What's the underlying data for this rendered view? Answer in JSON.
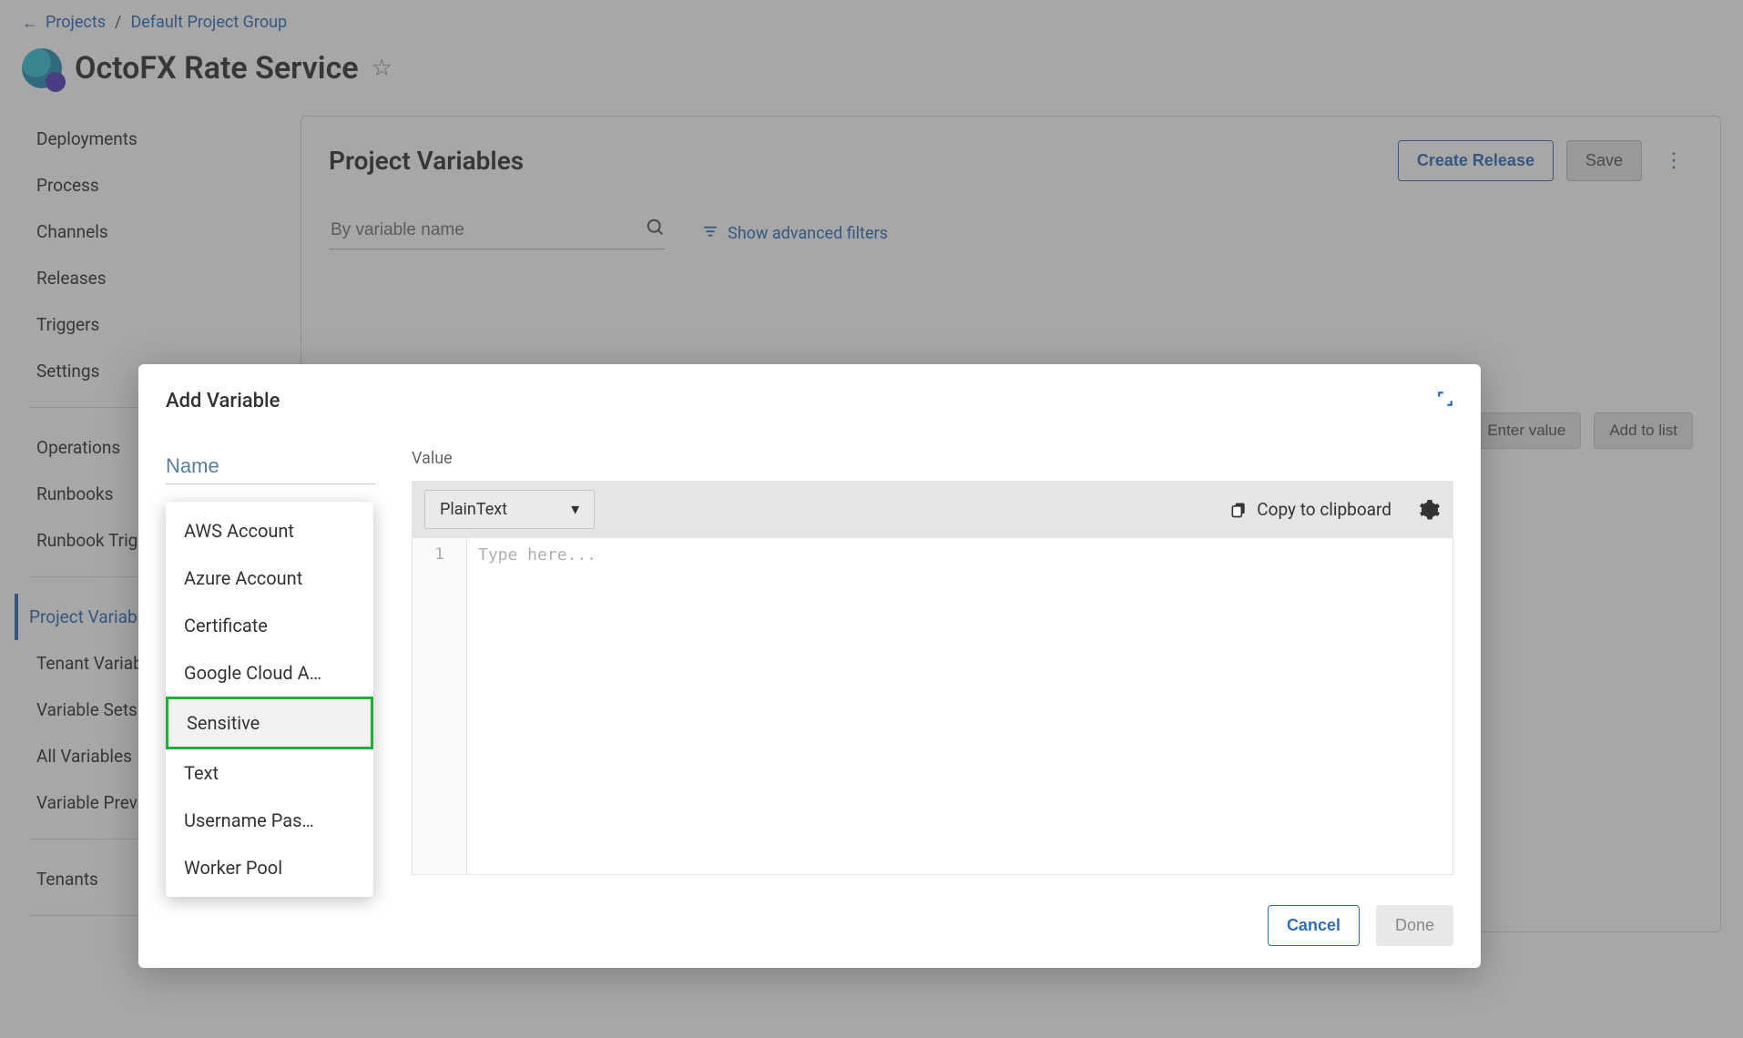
{
  "breadcrumbs": {
    "projects": "Projects",
    "group": "Default Project Group"
  },
  "project_title": "OctoFX Rate Service",
  "sidebar": {
    "items": [
      "Deployments",
      "Process",
      "Channels",
      "Releases",
      "Triggers",
      "Settings"
    ],
    "items2": [
      "Operations",
      "Runbooks",
      "Runbook Triggers"
    ],
    "items3": [
      "Project Variables",
      "Tenant Variables",
      "Variable Sets",
      "All Variables",
      "Variable Preview"
    ],
    "items4": [
      "Tenants"
    ]
  },
  "main": {
    "title": "Project Variables",
    "create_release": "Create Release",
    "save": "Save",
    "search_placeholder": "By variable name",
    "adv_filters": "Show advanced filters",
    "value_btn": "Enter value",
    "addlist_btn": "Add to list"
  },
  "modal": {
    "title": "Add Variable",
    "name_placeholder": "Name",
    "value_label": "Value",
    "type_selected": "PlainText",
    "copy": "Copy to clipboard",
    "editor_placeholder": "Type here...",
    "gutter": "1",
    "cancel": "Cancel",
    "done": "Done"
  },
  "dropdown": {
    "items": [
      "AWS Account",
      "Azure Account",
      "Certificate",
      "Google Cloud A…",
      "Sensitive",
      "Text",
      "Username Pas…",
      "Worker Pool"
    ],
    "highlight_index": 4
  }
}
